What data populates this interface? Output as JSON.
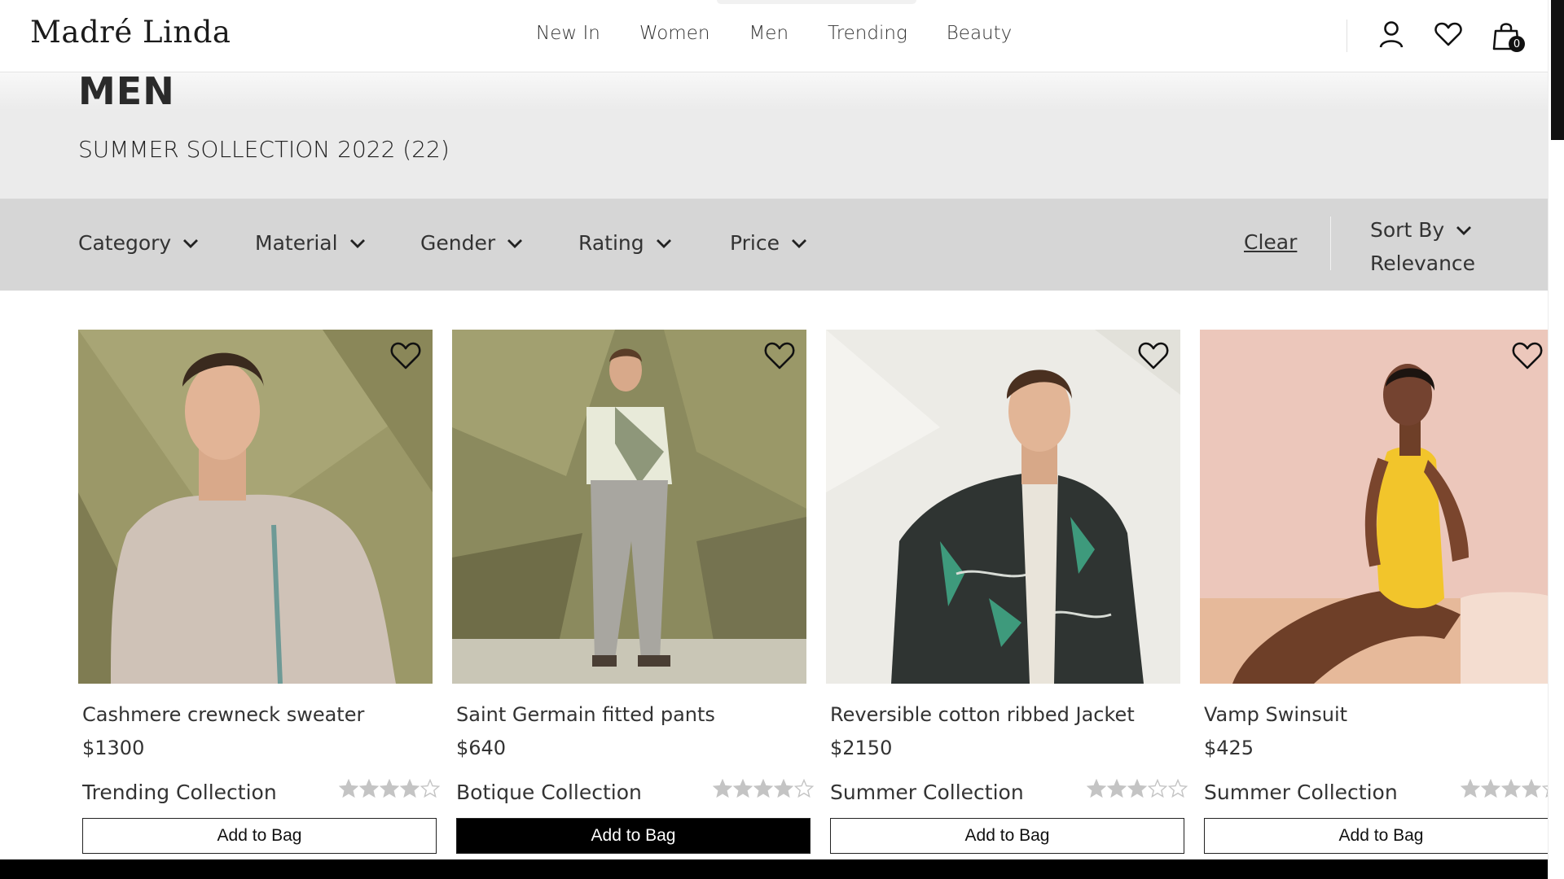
{
  "brand": {
    "name": "Madré Linda"
  },
  "nav": [
    "New In",
    "Women",
    "Men",
    "Trending",
    "Beauty"
  ],
  "header": {
    "bag_count": "0"
  },
  "hero": {
    "title": "MEN",
    "subtitle": "SUMMER SOLLECTION 2022 (22)"
  },
  "filters": [
    "Category",
    "Material",
    "Gender",
    "Rating",
    "Price"
  ],
  "clear_label": "Clear",
  "sort": {
    "label": "Sort By",
    "value": "Relevance"
  },
  "products": [
    {
      "name": "Cashmere crewneck sweater",
      "price": "$1300",
      "collection": "Trending Collection",
      "rating": 4,
      "button": "Add to Bag",
      "button_active": false
    },
    {
      "name": "Saint Germain fitted pants",
      "price": "$640",
      "collection": "Botique Collection",
      "rating": 4,
      "button": "Add to Bag",
      "button_active": true
    },
    {
      "name": "Reversible cotton ribbed Jacket",
      "price": "$2150",
      "collection": "Summer Collection",
      "rating": 3,
      "button": "Add to Bag",
      "button_active": false
    },
    {
      "name": "Vamp Swinsuit",
      "price": "$425",
      "collection": "Summer Collection",
      "rating": 4,
      "button": "Add to Bag",
      "button_active": false
    }
  ],
  "colors": {
    "accent": "#000000",
    "filter_bar": "#d6d6d6",
    "hero_bg": "#ebebeb"
  }
}
